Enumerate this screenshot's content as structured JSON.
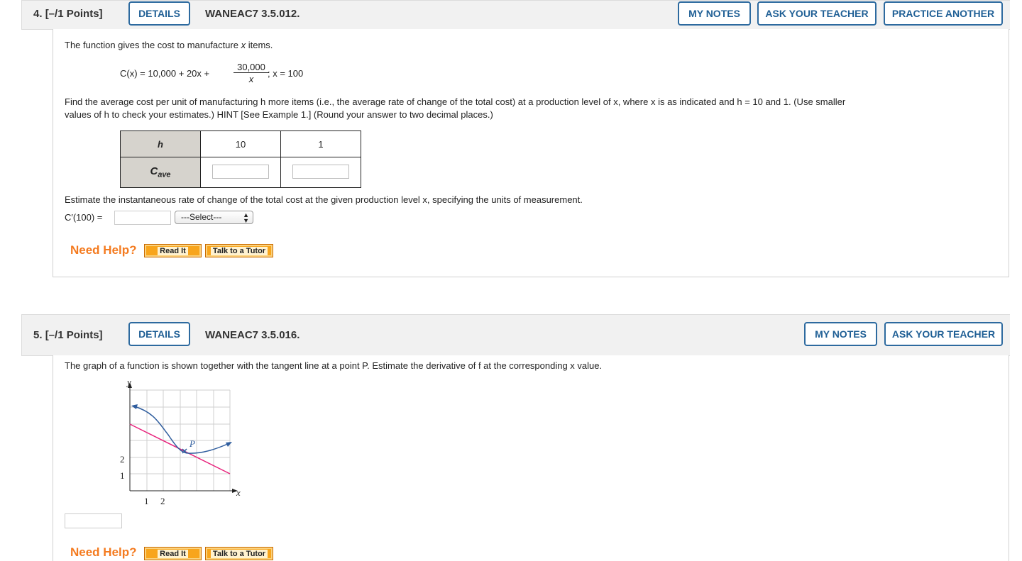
{
  "q4": {
    "number": "4.",
    "points": "[–/1 Points]",
    "details_label": "DETAILS",
    "id": "WANEAC7 3.5.012.",
    "my_notes_label": "MY NOTES",
    "ask_teacher_label": "ASK YOUR TEACHER",
    "practice_another_label": "PRACTICE ANOTHER",
    "intro": "The function gives the cost to manufacture",
    "intro_var": "x",
    "intro_end": "items.",
    "formula_lhs": "C(x) = 10,000 + 20x +",
    "formula_num": "30,000",
    "formula_den": "x",
    "formula_rhs": "; x = 100",
    "instruction_line1": "Find the average cost per unit of manufacturing h more items (i.e., the average rate of change of the total cost) at a production level of x, where x is as indicated and h = 10 and 1. (Use smaller",
    "instruction_line2": "values of h to check your estimates.) HINT [See Example 1.] (Round your answer to two decimal places.)",
    "table": {
      "row1_header": "h",
      "row2_header": "C",
      "row2_sub": "ave",
      "h_values": [
        "10",
        "1"
      ]
    },
    "estimate_text": "Estimate the instantaneous rate of change of the total cost at the given production level x, specifying the units of measurement.",
    "derivative_label": "C′(100) =",
    "select_label": "---Select---",
    "need_help": "Need Help?",
    "read_it": "Read It",
    "talk_tutor": "Talk to a Tutor"
  },
  "q5": {
    "number": "5.",
    "points": "[–/1 Points]",
    "details_label": "DETAILS",
    "id": "WANEAC7 3.5.016.",
    "my_notes_label": "MY NOTES",
    "ask_teacher_label": "ASK YOUR TEACHER",
    "prompt": "The graph of a function is shown together with the tangent line at a point P. Estimate the derivative of f at the corresponding x value.",
    "graph": {
      "y_axis_label": "y",
      "x_axis_label": "x",
      "point_label": "P",
      "y_ticks": [
        "2",
        "1"
      ],
      "x_ticks": [
        "1",
        "2"
      ],
      "curve_color": "#2f5d9e",
      "tangent_color": "#e8237c"
    },
    "need_help": "Need Help?",
    "read_it": "Read It",
    "talk_tutor": "Talk to a Tutor"
  }
}
